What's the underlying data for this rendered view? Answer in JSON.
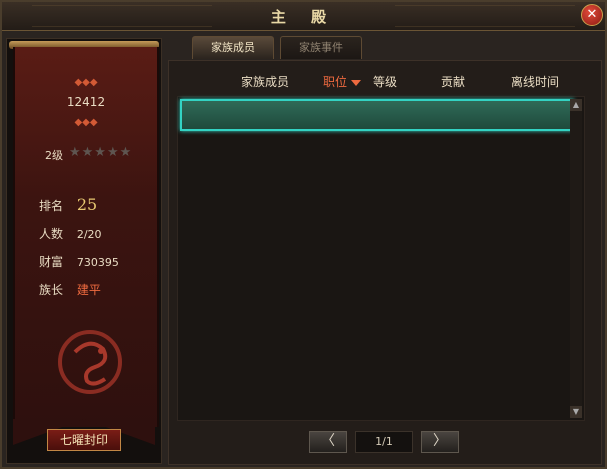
{
  "window": {
    "title": "主 殿",
    "close_icon": "close-icon"
  },
  "family": {
    "id_number": "12412",
    "level": "2级",
    "stars": "★★★★★",
    "rank_label": "排名",
    "rank_value": "25",
    "members_label": "人数",
    "members_value": "2/20",
    "wealth_label": "财富",
    "wealth_value": "730395",
    "leader_label": "族长",
    "leader_value": "建平",
    "seal_button": "七曜封印"
  },
  "tabs": [
    {
      "label": "家族成员"
    },
    {
      "label": "家族事件"
    }
  ],
  "table": {
    "headers": [
      "家族成员",
      "职位",
      "等级",
      "贡献",
      "离线时间"
    ]
  },
  "pager": {
    "prev_icon": "chevron-left-icon",
    "next_icon": "chevron-right-icon",
    "page": "1/1"
  },
  "colors": {
    "accent": "#ef6a3f",
    "selection": "#33d3c3",
    "banner": "#5a1c15"
  }
}
